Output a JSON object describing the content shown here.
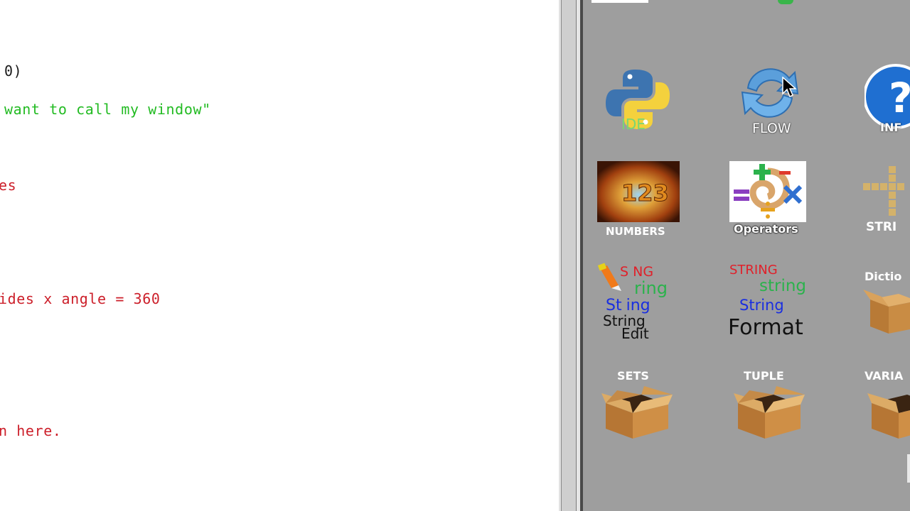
{
  "editor": {
    "lines": [
      {
        "text": "0)",
        "color": "black"
      },
      {
        "text": "want to call my window\"",
        "color": "green"
      },
      {
        "text": "es",
        "color": "red"
      },
      {
        "text": "ides x angle = 360",
        "color": "red"
      },
      {
        "text": "n here.",
        "color": "red"
      }
    ]
  },
  "launcher": {
    "tiles": [
      {
        "label": "IDE",
        "icon": "python-icon"
      },
      {
        "label": "FLOW",
        "icon": "refresh-arrows-icon"
      },
      {
        "label": "INF",
        "icon": "info-question-icon"
      },
      {
        "label": "NUMBERS",
        "icon": "numbers-123-icon"
      },
      {
        "label": "Operators",
        "icon": "operators-icon"
      },
      {
        "label": "STRI",
        "icon": "scrabble-tiles-icon"
      },
      {
        "label": "String Edit",
        "icon": "string-edit-icon",
        "words": [
          "S",
          "NG",
          "ring",
          "St",
          "ing",
          "String",
          "Edit"
        ]
      },
      {
        "label": "String Format",
        "icon": "string-format-icon",
        "words": [
          "STRING",
          "string",
          "String",
          "Format"
        ]
      },
      {
        "label": "Dictio",
        "icon": "box-icon"
      },
      {
        "label": "SETS",
        "icon": "box-icon"
      },
      {
        "label": "TUPLE",
        "icon": "box-icon"
      },
      {
        "label": "VARIA",
        "icon": "box-icon"
      }
    ],
    "colors": {
      "background": "#9e9e9e",
      "code_green": "#22bb22",
      "code_red": "#cc1f2a"
    }
  }
}
